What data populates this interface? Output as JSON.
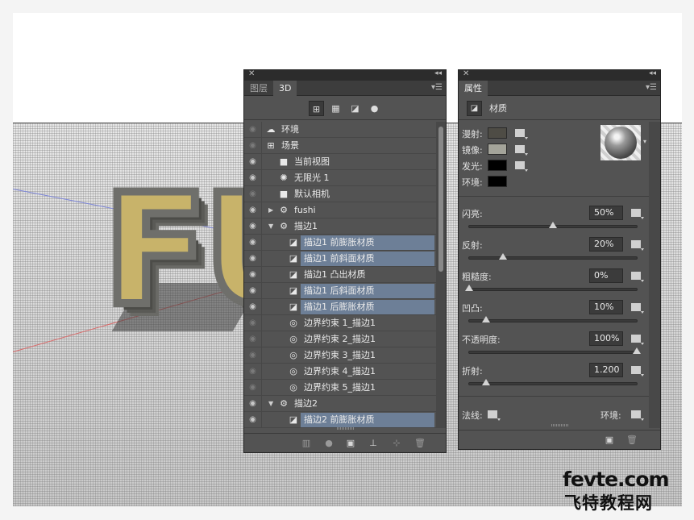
{
  "layers_panel": {
    "tabs": [
      {
        "label": "图层"
      },
      {
        "label": "3D"
      }
    ],
    "filter_icons": [
      "scene-filter-icon",
      "mesh-filter-icon",
      "material-filter-icon",
      "light-filter-icon"
    ],
    "rows": [
      {
        "label": "环境",
        "icon": "environment-icon",
        "indent": 0,
        "twisty": "",
        "visible": false,
        "highlight": false
      },
      {
        "label": "场景",
        "icon": "scene-icon",
        "indent": 0,
        "twisty": "",
        "visible": false,
        "highlight": false
      },
      {
        "label": "当前视图",
        "icon": "camera-icon",
        "indent": 1,
        "twisty": "",
        "visible": true,
        "highlight": false
      },
      {
        "label": "无限光 1",
        "icon": "infinite-light-icon",
        "indent": 1,
        "twisty": "",
        "visible": true,
        "highlight": false
      },
      {
        "label": "默认相机",
        "icon": "camera-icon",
        "indent": 1,
        "twisty": "",
        "visible": false,
        "highlight": false
      },
      {
        "label": "fushi",
        "icon": "mesh-icon",
        "indent": 1,
        "twisty": "right",
        "visible": true,
        "highlight": false
      },
      {
        "label": "描边1",
        "icon": "mesh-icon",
        "indent": 1,
        "twisty": "down",
        "visible": true,
        "highlight": false
      },
      {
        "label": "描边1 前膨胀材质",
        "icon": "material-icon",
        "indent": 2,
        "twisty": "",
        "visible": true,
        "highlight": true
      },
      {
        "label": "描边1 前斜面材质",
        "icon": "material-icon",
        "indent": 2,
        "twisty": "",
        "visible": true,
        "highlight": true
      },
      {
        "label": "描边1 凸出材质",
        "icon": "material-icon",
        "indent": 2,
        "twisty": "",
        "visible": true,
        "highlight": false
      },
      {
        "label": "描边1 后斜面材质",
        "icon": "material-icon",
        "indent": 2,
        "twisty": "",
        "visible": true,
        "highlight": true
      },
      {
        "label": "描边1 后膨胀材质",
        "icon": "material-icon",
        "indent": 2,
        "twisty": "",
        "visible": true,
        "highlight": true
      },
      {
        "label": "边界约束 1_描边1",
        "icon": "constraint-icon",
        "indent": 2,
        "twisty": "",
        "visible": false,
        "highlight": false
      },
      {
        "label": "边界约束 2_描边1",
        "icon": "constraint-icon",
        "indent": 2,
        "twisty": "",
        "visible": false,
        "highlight": false
      },
      {
        "label": "边界约束 3_描边1",
        "icon": "constraint-icon",
        "indent": 2,
        "twisty": "",
        "visible": false,
        "highlight": false
      },
      {
        "label": "边界约束 4_描边1",
        "icon": "constraint-icon",
        "indent": 2,
        "twisty": "",
        "visible": false,
        "highlight": false
      },
      {
        "label": "边界约束 5_描边1",
        "icon": "constraint-icon",
        "indent": 2,
        "twisty": "",
        "visible": false,
        "highlight": false
      },
      {
        "label": "描边2",
        "icon": "mesh-icon",
        "indent": 1,
        "twisty": "down",
        "visible": true,
        "highlight": false
      },
      {
        "label": "描边2 前膨胀材质",
        "icon": "material-icon",
        "indent": 2,
        "twisty": "",
        "visible": true,
        "highlight": true
      }
    ],
    "bottom_icons": [
      "render-icon",
      "new-light-icon",
      "new-mesh-icon",
      "ground-icon",
      "add-constraint-icon",
      "trash-icon"
    ]
  },
  "properties_panel": {
    "tab": "属性",
    "title": "材质",
    "color_rows": [
      {
        "label": "漫射:",
        "color": "#4e4c45"
      },
      {
        "label": "镜像:",
        "color": "#a4a49a"
      },
      {
        "label": "发光:",
        "color": "#000000"
      },
      {
        "label": "环境:",
        "color": "#000000"
      }
    ],
    "sliders": [
      {
        "label": "闪亮:",
        "value": "50%",
        "fraction": 0.5
      },
      {
        "label": "反射:",
        "value": "20%",
        "fraction": 0.2
      },
      {
        "label": "粗糙度:",
        "value": "0%",
        "fraction": 0.0
      },
      {
        "label": "凹凸:",
        "value": "10%",
        "fraction": 0.1
      },
      {
        "label": "不透明度:",
        "value": "100%",
        "fraction": 1.0
      },
      {
        "label": "折射:",
        "value": "1.200",
        "fraction": 0.1
      }
    ],
    "normal_label": "法线:",
    "environment_label": "环境:"
  },
  "watermark": {
    "brand_en": "fevte.com",
    "brand_zh": "飞特教程网"
  }
}
